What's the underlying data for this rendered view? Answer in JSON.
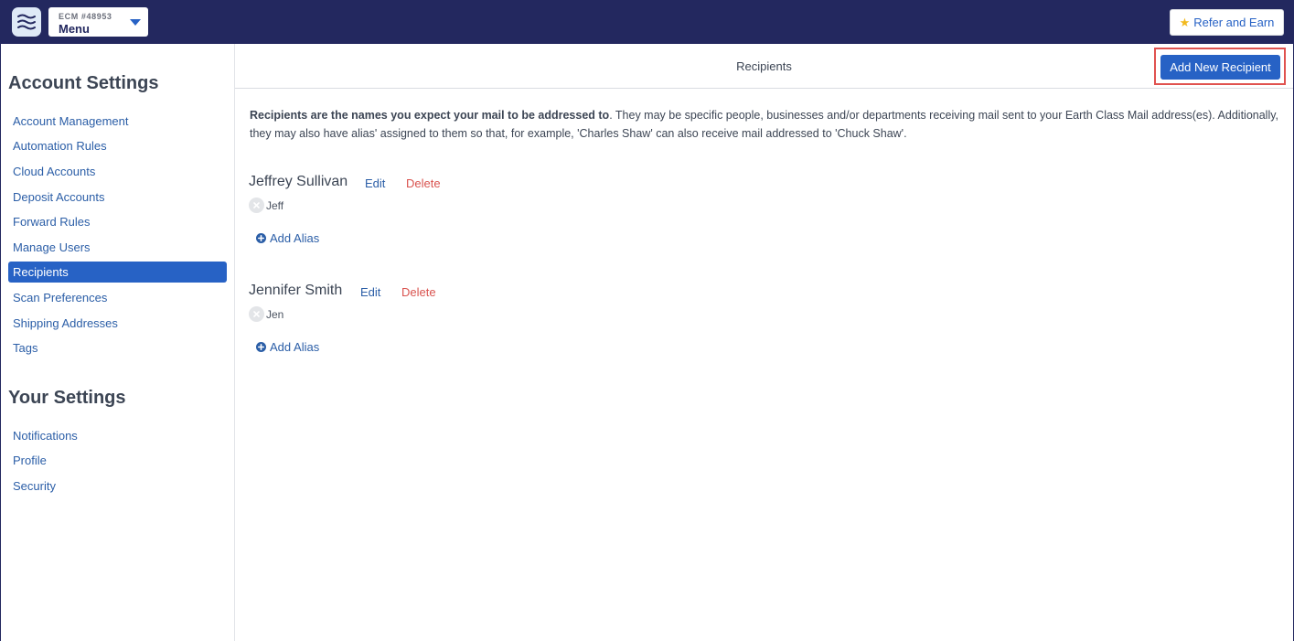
{
  "topbar": {
    "account_id": "ECM #48953",
    "menu_label": "Menu",
    "refer_label": "Refer and Earn"
  },
  "sidebar": {
    "account_heading": "Account Settings",
    "account_items": [
      {
        "label": "Account Management"
      },
      {
        "label": "Automation Rules"
      },
      {
        "label": "Cloud Accounts"
      },
      {
        "label": "Deposit Accounts"
      },
      {
        "label": "Forward Rules"
      },
      {
        "label": "Manage Users"
      },
      {
        "label": "Recipients",
        "active": true
      },
      {
        "label": "Scan Preferences"
      },
      {
        "label": "Shipping Addresses"
      },
      {
        "label": "Tags"
      }
    ],
    "your_heading": "Your Settings",
    "your_items": [
      {
        "label": "Notifications"
      },
      {
        "label": "Profile"
      },
      {
        "label": "Security"
      }
    ]
  },
  "main": {
    "title": "Recipients",
    "add_button": "Add New Recipient",
    "intro_bold": "Recipients are the names you expect your mail to be addressed to",
    "intro_rest": ". They may be specific people, businesses and/or departments receiving mail sent to your Earth Class Mail address(es). Additionally, they may also have alias' assigned to them so that, for example, 'Charles Shaw' can also receive mail addressed to 'Chuck Shaw'.",
    "edit_label": "Edit",
    "delete_label": "Delete",
    "add_alias_label": "Add Alias",
    "recipients": [
      {
        "name": "Jeffrey Sullivan",
        "aliases": [
          "Jeff"
        ]
      },
      {
        "name": "Jennifer Smith",
        "aliases": [
          "Jen"
        ]
      }
    ]
  },
  "colors": {
    "brand_navy": "#23285f",
    "primary_blue": "#2762c5",
    "link_blue": "#2b5ea7",
    "danger_red": "#d9534f",
    "highlight_red": "#e0524f",
    "star_gold": "#f2b91d"
  }
}
